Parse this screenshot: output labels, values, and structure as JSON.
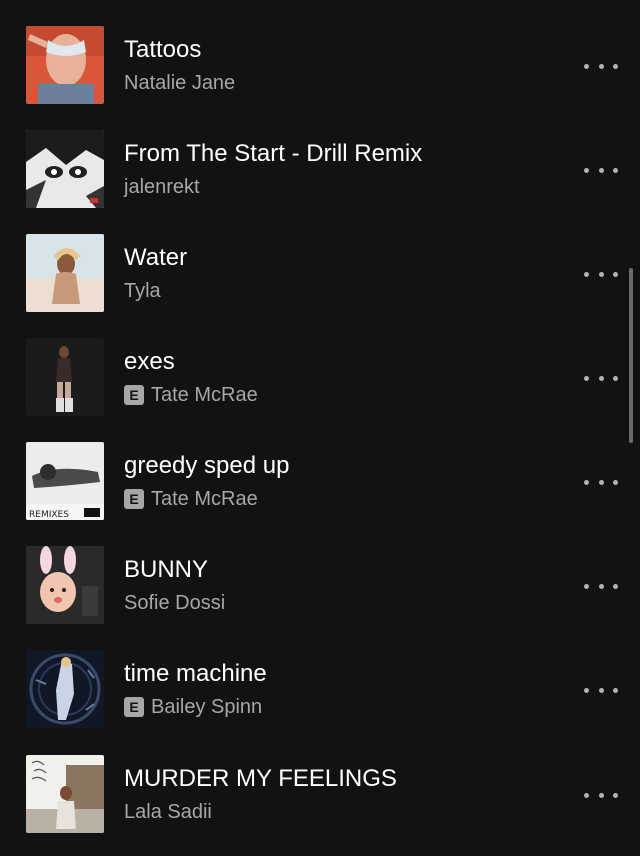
{
  "tracks": [
    {
      "title": "Tattoos",
      "artist": "Natalie Jane",
      "explicit": false,
      "cover_icon": "album-cover-tattoos",
      "explicit_label": ""
    },
    {
      "title": "From The Start - Drill Remix",
      "artist": "jalenrekt",
      "explicit": false,
      "cover_icon": "album-cover-from-the-start",
      "explicit_label": ""
    },
    {
      "title": "Water",
      "artist": "Tyla",
      "explicit": false,
      "cover_icon": "album-cover-water",
      "explicit_label": ""
    },
    {
      "title": "exes",
      "artist": "Tate McRae",
      "explicit": true,
      "cover_icon": "album-cover-exes",
      "explicit_label": "E"
    },
    {
      "title": "greedy sped up",
      "artist": "Tate McRae",
      "explicit": true,
      "cover_icon": "album-cover-greedy",
      "explicit_label": "E",
      "cover_text": "REMIXES"
    },
    {
      "title": "BUNNY",
      "artist": "Sofie Dossi",
      "explicit": false,
      "cover_icon": "album-cover-bunny",
      "explicit_label": ""
    },
    {
      "title": "time machine",
      "artist": "Bailey Spinn",
      "explicit": true,
      "cover_icon": "album-cover-time-machine",
      "explicit_label": "E"
    },
    {
      "title": "MURDER MY FEELINGS",
      "artist": "Lala Sadii",
      "explicit": false,
      "cover_icon": "album-cover-murder-my-feelings",
      "explicit_label": ""
    }
  ],
  "more_icon": "more-options-icon",
  "colors": {
    "background": "#121212",
    "title": "#ffffff",
    "subtitle": "#a7a7a7"
  }
}
